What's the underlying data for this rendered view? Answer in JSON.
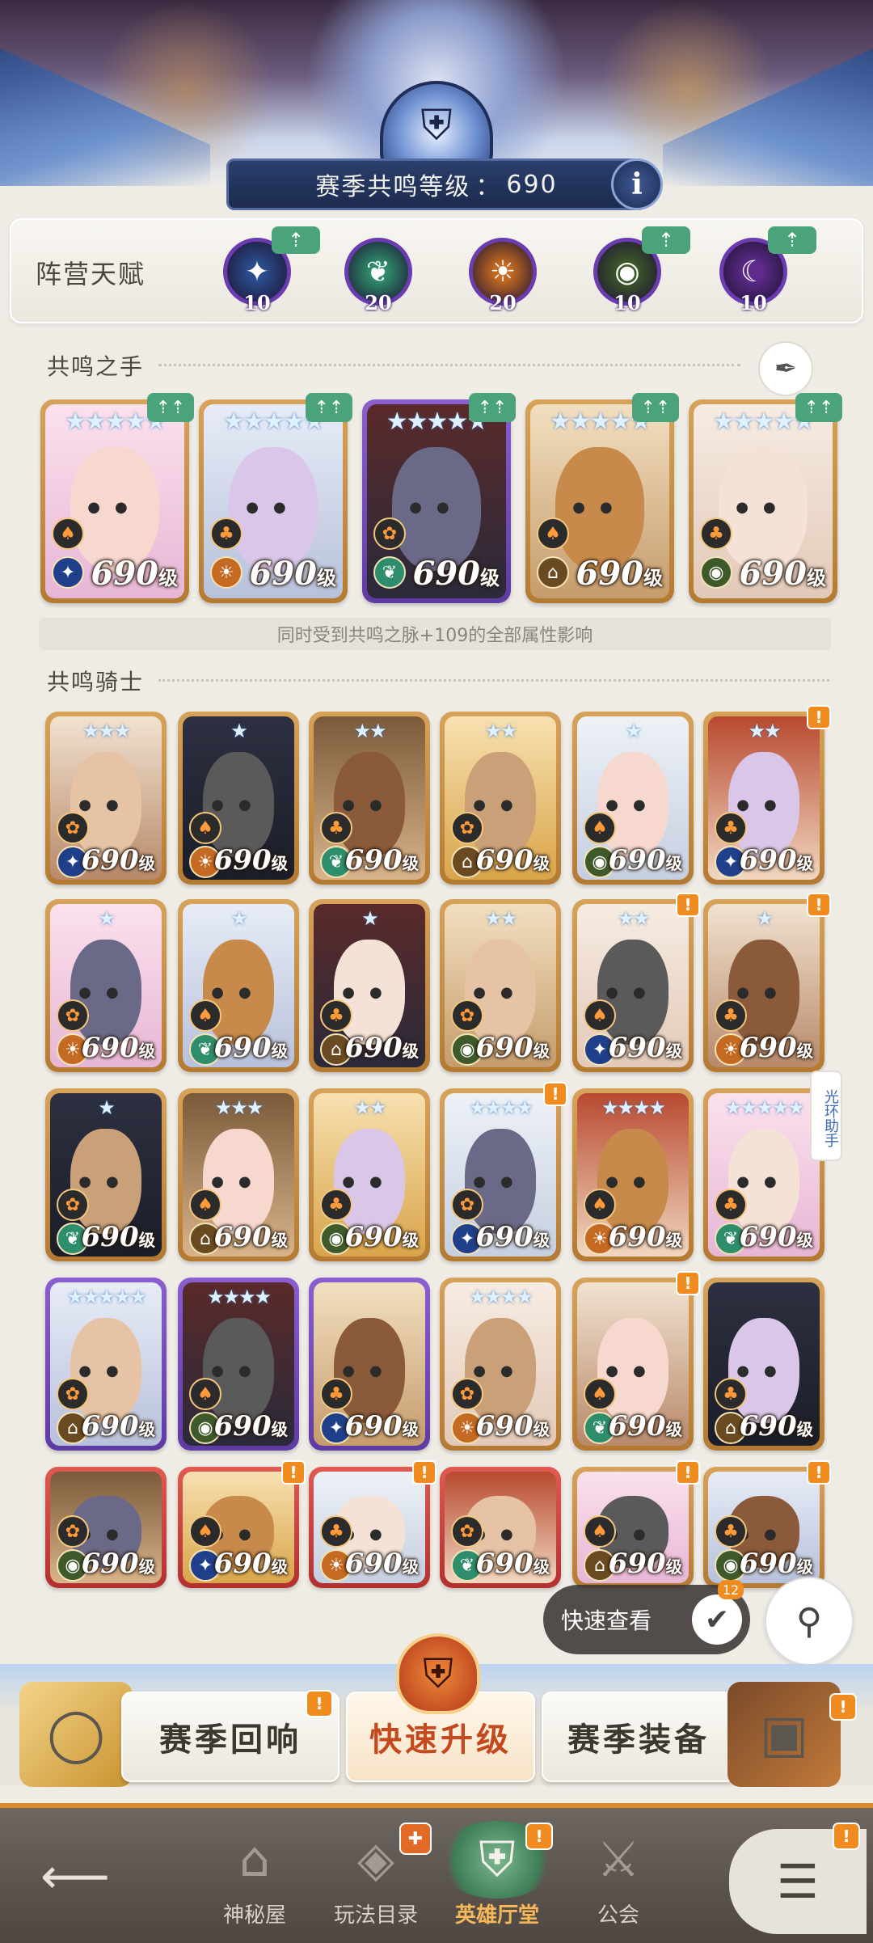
{
  "header": {
    "resonance_label": "赛季共鸣等级",
    "resonance_sep": "：",
    "resonance_level": "690",
    "info_icon": "i"
  },
  "faction": {
    "label": "阵营天赋",
    "badges": [
      {
        "value": "10",
        "icon": "star-compass-icon",
        "color": "#2b4c8c",
        "upgrade": true
      },
      {
        "value": "20",
        "icon": "leaf-icon",
        "color": "#2e8d6b",
        "upgrade": false
      },
      {
        "value": "20",
        "icon": "sun-icon",
        "color": "#c46a22",
        "upgrade": false
      },
      {
        "value": "10",
        "icon": "eye-icon",
        "color": "#3f5a2a",
        "upgrade": true
      },
      {
        "value": "10",
        "icon": "half-moon-icon",
        "color": "#5e2b8c",
        "upgrade": true
      }
    ],
    "upgrade_icon": "⇡"
  },
  "hand_section": {
    "title": "共鸣之手",
    "note": "同时受到共鸣之脉+109的全部属性影响"
  },
  "knights_section": {
    "title": "共鸣骑士",
    "side_tab": "光环助手"
  },
  "level_text": "690",
  "level_unit": "级",
  "quick_view": {
    "label": "快速查看",
    "count": "12"
  },
  "actions": {
    "left": "赛季回响",
    "middle": "快速升级",
    "right": "赛季装备"
  },
  "nav": {
    "items": [
      {
        "label": "神秘屋",
        "icon": "mystery-house-icon"
      },
      {
        "label": "玩法目录",
        "icon": "gameplay-catalog-icon"
      },
      {
        "label": "英雄厅堂",
        "icon": "hero-hall-icon"
      },
      {
        "label": "公会",
        "icon": "guild-icon"
      }
    ]
  }
}
